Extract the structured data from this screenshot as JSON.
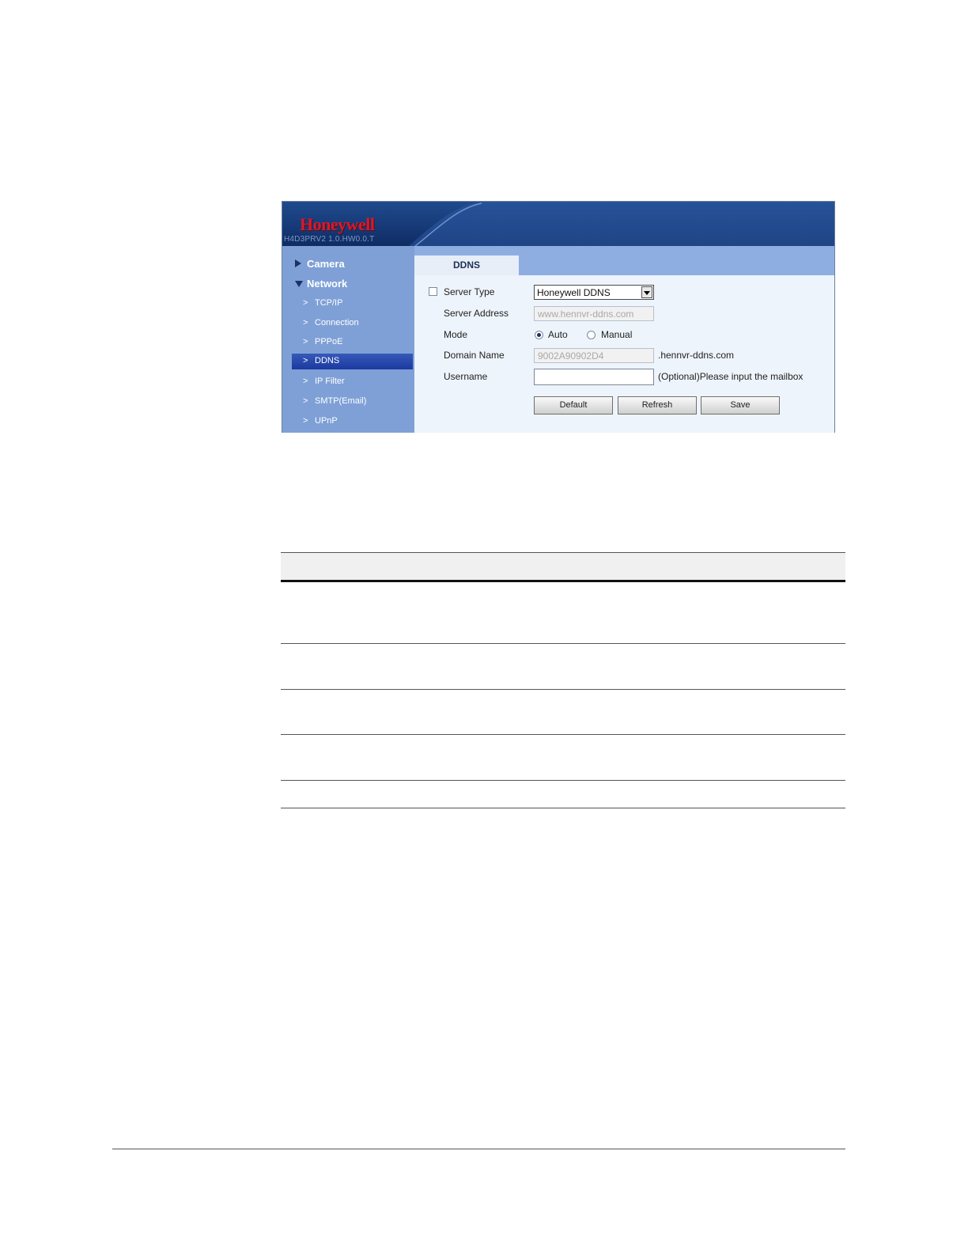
{
  "screenshot": {
    "brand": "Honeywell",
    "version": "H4D3PRV2 1.0.HW0.0.T",
    "sidebar": {
      "groups": [
        {
          "label": "Camera",
          "expanded": false
        },
        {
          "label": "Network",
          "expanded": true
        }
      ],
      "items": [
        {
          "label": "TCP/IP"
        },
        {
          "label": "Connection"
        },
        {
          "label": "PPPoE"
        },
        {
          "label": "DDNS",
          "active": true
        },
        {
          "label": "IP Filter"
        },
        {
          "label": "SMTP(Email)"
        },
        {
          "label": "UPnP"
        }
      ]
    },
    "tab": "DDNS",
    "form": {
      "server_type_label": "Server Type",
      "server_type_value": "Honeywell DDNS",
      "server_address_label": "Server Address",
      "server_address_value": "www.hennvr-ddns.com",
      "mode_label": "Mode",
      "mode_auto": "Auto",
      "mode_manual": "Manual",
      "domain_name_label": "Domain Name",
      "domain_name_value": "9002A90902D4",
      "domain_suffix": ".hennvr-ddns.com",
      "username_label": "Username",
      "username_value": "",
      "username_hint": "(Optional)Please input the mailbox"
    },
    "buttons": {
      "default": "Default",
      "refresh": "Refresh",
      "save": "Save"
    },
    "colors": {
      "banner": "#173a78",
      "sidebar": "#7fa0d6",
      "active_item": "#1c3aa0",
      "brand_red": "#d61a2a"
    }
  }
}
